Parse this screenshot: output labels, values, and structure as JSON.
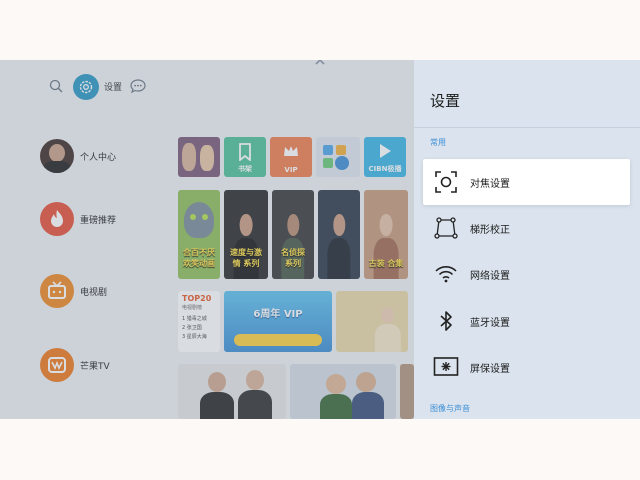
{
  "topbar": {
    "settings_label": "设置",
    "icons": [
      "search-icon",
      "gear-icon",
      "chat-bubble-icon",
      "chevron-up-icon"
    ]
  },
  "sidebar": {
    "items": [
      {
        "label": "个人中心",
        "icon": "avatar"
      },
      {
        "label": "重磅推荐",
        "icon": "flame-icon",
        "color": "#e8503a"
      },
      {
        "label": "电视剧",
        "icon": "tv-icon",
        "color": "#f08a24"
      },
      {
        "label": "芒果TV",
        "icon": "mango-tv-icon",
        "color": "#f07a1e"
      }
    ]
  },
  "apps": {
    "tiles": [
      {
        "caption": "",
        "color": "#7b5a7a"
      },
      {
        "caption": "书架",
        "color": "#4fc29a"
      },
      {
        "caption": "VIP",
        "color": "#f07f4e"
      },
      {
        "caption": "",
        "color": "#dfe6f0"
      },
      {
        "caption": "CIBN极播",
        "color": "#3bb6e6"
      }
    ]
  },
  "posters": [
    {
      "caption": "合百不厌 欢笑动画",
      "bg": "#8fbf5a"
    },
    {
      "caption": "速度与激情 系列",
      "bg": "#2c2c2c"
    },
    {
      "caption": "名侦探 系列",
      "bg": "#3b3b3b"
    },
    {
      "caption": "",
      "bg": "#2f3a4a"
    },
    {
      "caption": "古装 合集",
      "bg": "#c79a7a"
    }
  ],
  "banner": {
    "top20_title": "TOP20",
    "top20_sub": "电视剧榜",
    "top20_list": [
      "1 猎毒之城",
      "2 张卫国",
      "3 星辰大海"
    ],
    "promo_title": "6周年 VIP",
    "promo_color": "#46a7e0"
  },
  "panel": {
    "title": "设置",
    "section_common": "常用",
    "section_av": "图像与声音",
    "items": [
      {
        "label": "对焦设置",
        "icon": "focus-icon",
        "active": true
      },
      {
        "label": "梯形校正",
        "icon": "keystone-icon",
        "active": false
      },
      {
        "label": "网络设置",
        "icon": "wifi-icon",
        "active": false
      },
      {
        "label": "蓝牙设置",
        "icon": "bluetooth-icon",
        "active": false
      },
      {
        "label": "屏保设置",
        "icon": "screensaver-icon",
        "active": false
      }
    ],
    "accent": "#3d8fd6"
  }
}
